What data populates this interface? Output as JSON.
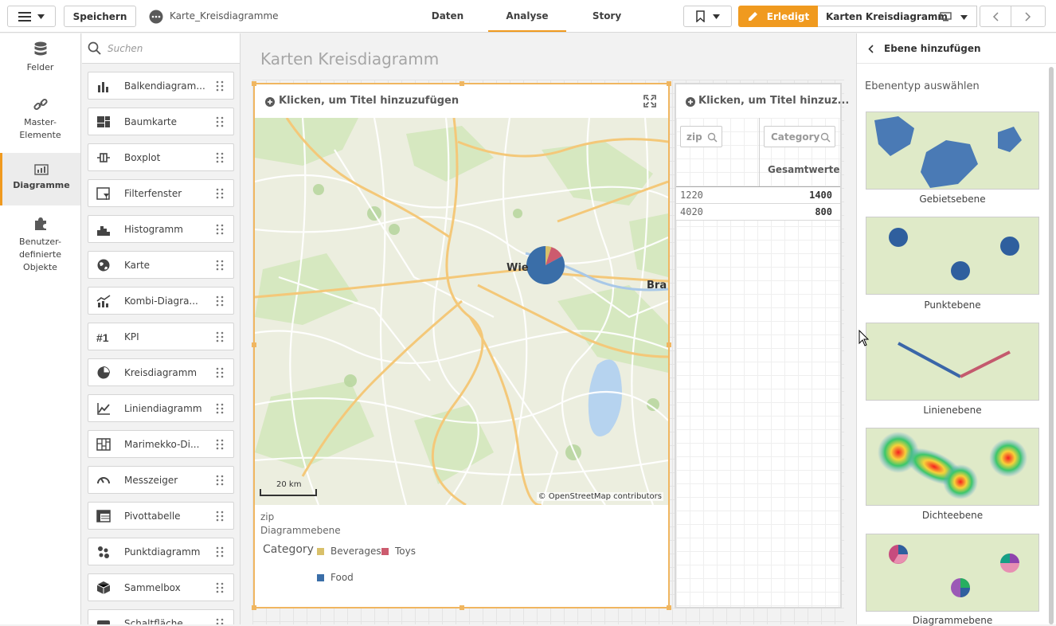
{
  "topbar": {
    "save_label": "Speichern",
    "app_name": "Karte_Kreisdiagramme",
    "tabs": [
      {
        "label": "Daten"
      },
      {
        "label": "Analyse"
      },
      {
        "label": "Story"
      }
    ],
    "done_label": "Erledigt",
    "sheet_name": "Karten Kreisdiagramm",
    "accent": "#f09a1f"
  },
  "leftnav": {
    "items": [
      {
        "label": "Felder",
        "icon": "database-icon"
      },
      {
        "label": "Master-\nElemente",
        "icon": "link-icon"
      },
      {
        "label": "Diagramme",
        "icon": "chart-icon"
      },
      {
        "label": "Benutzer-\ndefinierte\nObjekte",
        "icon": "puzzle-icon"
      }
    ]
  },
  "assets": {
    "search_placeholder": "Suchen",
    "items": [
      {
        "label": "Balkendiagram...",
        "icon": "bar-chart-icon"
      },
      {
        "label": "Baumkarte",
        "icon": "treemap-icon"
      },
      {
        "label": "Boxplot",
        "icon": "boxplot-icon"
      },
      {
        "label": "Filterfenster",
        "icon": "filter-pane-icon"
      },
      {
        "label": "Histogramm",
        "icon": "histogram-icon"
      },
      {
        "label": "Karte",
        "icon": "globe-icon"
      },
      {
        "label": "Kombi-Diagra...",
        "icon": "combo-chart-icon"
      },
      {
        "label": "KPI",
        "icon": "kpi-icon"
      },
      {
        "label": "Kreisdiagramm",
        "icon": "pie-chart-icon"
      },
      {
        "label": "Liniendiagramm",
        "icon": "line-chart-icon"
      },
      {
        "label": "Marimekko-Di...",
        "icon": "marimekko-icon"
      },
      {
        "label": "Messzeiger",
        "icon": "gauge-icon"
      },
      {
        "label": "Pivottabelle",
        "icon": "pivot-table-icon"
      },
      {
        "label": "Punktdiagramm",
        "icon": "scatter-icon"
      },
      {
        "label": "Sammelbox",
        "icon": "container-icon"
      },
      {
        "label": "Schaltfläche",
        "icon": "button-icon"
      }
    ]
  },
  "sheet": {
    "title": "Karten Kreisdiagramm"
  },
  "map_object": {
    "title_placeholder": "Klicken, um Titel hinzuzufügen",
    "city_label": "Wie",
    "city_label_2": "Bra",
    "scale_label": "20 km",
    "attribution": "© OpenStreetMap contributors",
    "legend_field": "zip",
    "legend_layer": "Diagrammebene",
    "legend_title": "Category",
    "categories": [
      {
        "label": "Beverages",
        "color": "#d9c06a"
      },
      {
        "label": "Toys",
        "color": "#cc5b6e"
      },
      {
        "label": "Food",
        "color": "#3a6ea8"
      }
    ],
    "pie_shares": [
      0.05,
      0.12,
      0.83
    ]
  },
  "table_object": {
    "title_placeholder": "Klicken, um Titel hinzuz...",
    "col1_search": "zip",
    "col2_search": "Category",
    "col2_header": "Gesamtwerte",
    "rows": [
      {
        "zip": "1220",
        "value": "1400"
      },
      {
        "zip": "4020",
        "value": "800"
      }
    ]
  },
  "rightpanel": {
    "back_label": "Ebene hinzufügen",
    "section_label": "Ebenentyp auswählen",
    "layers": [
      {
        "label": "Gebietsebene"
      },
      {
        "label": "Punktebene"
      },
      {
        "label": "Linienebene"
      },
      {
        "label": "Dichteebene"
      },
      {
        "label": "Diagrammebene"
      }
    ]
  }
}
